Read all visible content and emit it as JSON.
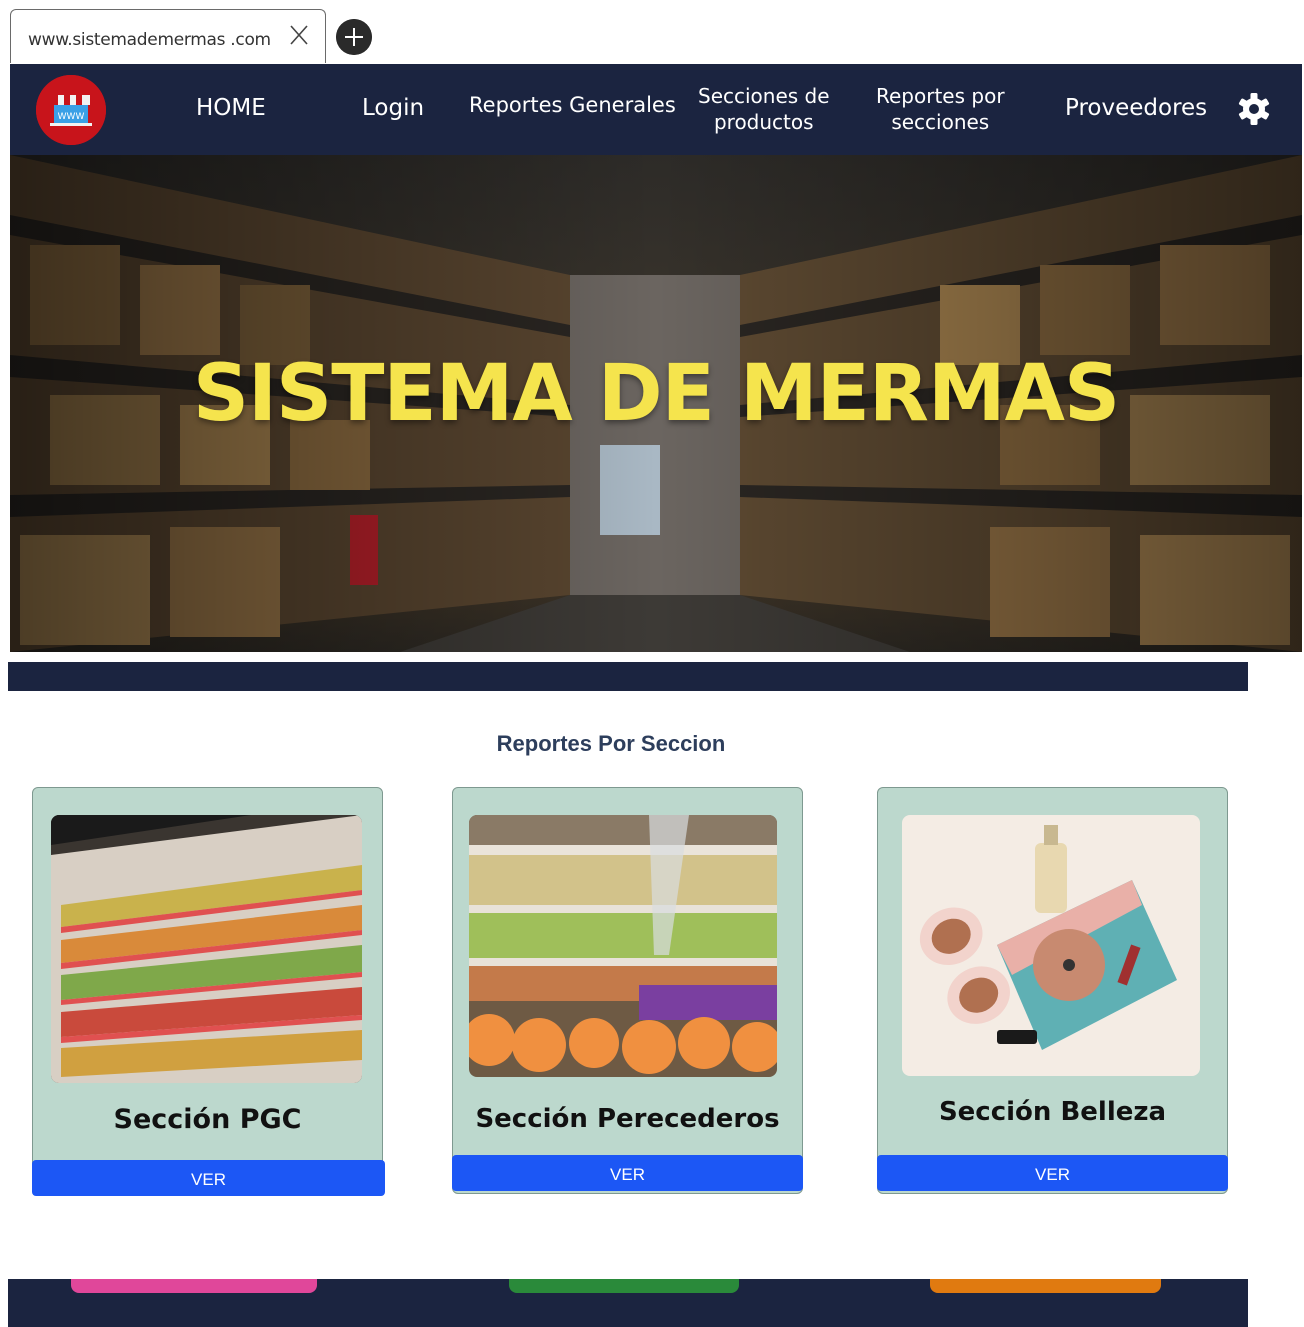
{
  "browser": {
    "url": "www.sistemademermas .com",
    "close_icon": "close-icon",
    "new_tab_icon": "plus-icon"
  },
  "nav": {
    "logo_text": "WWW",
    "items": [
      {
        "label": "HOME"
      },
      {
        "label": "Login"
      },
      {
        "label": "Reportes Generales"
      },
      {
        "line1": "Secciones de",
        "line2": "productos"
      },
      {
        "line1": "Reportes por",
        "line2": "secciones"
      },
      {
        "label": "Proveedores"
      }
    ],
    "settings_icon": "gear-icon"
  },
  "hero": {
    "title": "SISTEMA DE MERMAS"
  },
  "section": {
    "title": "Reportes Por Seccion"
  },
  "cards": [
    {
      "title": "Sección PGC",
      "button": "VER",
      "image": "supermarket-shelves"
    },
    {
      "title": "Sección Perecederos",
      "button": "VER",
      "image": "produce-market"
    },
    {
      "title": "Sección Belleza",
      "button": "VER",
      "image": "beauty-products"
    }
  ],
  "footer": {
    "button_colors": [
      "#e0479a",
      "#2a8a3a",
      "#e07a10"
    ]
  },
  "colors": {
    "navbar": "#1b2440",
    "hero_title": "#f5e44d",
    "card_bg": "#bcd8cd",
    "button_blue": "#1c57f5",
    "logo_red": "#c8141b"
  }
}
